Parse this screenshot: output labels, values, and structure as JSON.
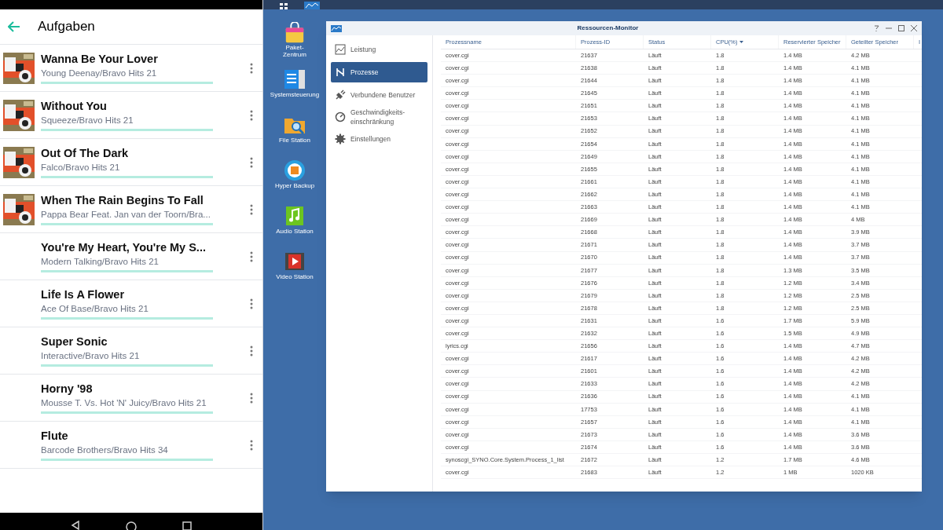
{
  "phone": {
    "header": {
      "title": "Aufgaben"
    },
    "tasks": [
      {
        "title": "Wanna Be Your Lover",
        "subtitle": "Young Deenay/Bravo Hits 21",
        "has_cover": true,
        "level": 1
      },
      {
        "title": "Without You",
        "subtitle": "Squeeze/Bravo Hits 21",
        "has_cover": true,
        "level": 1
      },
      {
        "title": "Out Of The Dark",
        "subtitle": "Falco/Bravo Hits 21",
        "has_cover": true,
        "level": 1
      },
      {
        "title": "When The Rain Begins To Fall",
        "subtitle": "Pappa Bear Feat. Jan van der Toorn/Bra...",
        "has_cover": true,
        "level": 1
      },
      {
        "title": "You're My Heart, You're My S...",
        "subtitle": "Modern Talking/Bravo Hits 21",
        "has_cover": false,
        "level": 1
      },
      {
        "title": "Life Is A Flower",
        "subtitle": "Ace Of Base/Bravo Hits 21",
        "has_cover": false,
        "level": 1
      },
      {
        "title": "Super Sonic",
        "subtitle": "Interactive/Bravo Hits 21",
        "has_cover": false,
        "level": 1
      },
      {
        "title": "Horny '98",
        "subtitle": "Mousse T. Vs. Hot 'N' Juicy/Bravo Hits 21",
        "has_cover": false,
        "level": 1
      },
      {
        "title": "Flute",
        "subtitle": "Barcode Brothers/Bravo Hits 34",
        "has_cover": false,
        "level": 1
      }
    ]
  },
  "desktop": {
    "icons": [
      {
        "label": "Paket-\nZentrum",
        "kind": "package"
      },
      {
        "label": "Systemsteuerung",
        "kind": "control"
      },
      {
        "label": "File Station",
        "kind": "folder"
      },
      {
        "label": "Hyper Backup",
        "kind": "backup"
      },
      {
        "label": "Audio Station",
        "kind": "audio"
      },
      {
        "label": "Video Station",
        "kind": "video"
      }
    ]
  },
  "window": {
    "title": "Ressourcen-Monitor",
    "sidebar": [
      {
        "label": "Leistung",
        "kind": "chart",
        "selected": false
      },
      {
        "label": "Prozesse",
        "kind": "process",
        "selected": true
      },
      {
        "label": "Verbundene Benutzer",
        "kind": "plug",
        "selected": false
      },
      {
        "label": "Geschwindigkeits-\neinschränkung",
        "kind": "gauge",
        "selected": false
      },
      {
        "label": "Einstellungen",
        "kind": "gear",
        "selected": false
      }
    ],
    "table": {
      "columns": [
        {
          "label": "Prozessname",
          "sorted": false
        },
        {
          "label": "Prozess-ID",
          "sorted": false
        },
        {
          "label": "Status",
          "sorted": false
        },
        {
          "label": "CPU(%)",
          "sorted": true
        },
        {
          "label": "Reservierter Speicher",
          "sorted": false
        },
        {
          "label": "Geteilter Speicher",
          "sorted": false
        },
        {
          "label": "I",
          "sorted": false
        }
      ],
      "rows": [
        [
          "cover.cgi",
          "21637",
          "Läuft",
          "1.8",
          "1.4 MB",
          "4.2 MB"
        ],
        [
          "cover.cgi",
          "21638",
          "Läuft",
          "1.8",
          "1.4 MB",
          "4.1 MB"
        ],
        [
          "cover.cgi",
          "21644",
          "Läuft",
          "1.8",
          "1.4 MB",
          "4.1 MB"
        ],
        [
          "cover.cgi",
          "21645",
          "Läuft",
          "1.8",
          "1.4 MB",
          "4.1 MB"
        ],
        [
          "cover.cgi",
          "21651",
          "Läuft",
          "1.8",
          "1.4 MB",
          "4.1 MB"
        ],
        [
          "cover.cgi",
          "21653",
          "Läuft",
          "1.8",
          "1.4 MB",
          "4.1 MB"
        ],
        [
          "cover.cgi",
          "21652",
          "Läuft",
          "1.8",
          "1.4 MB",
          "4.1 MB"
        ],
        [
          "cover.cgi",
          "21654",
          "Läuft",
          "1.8",
          "1.4 MB",
          "4.1 MB"
        ],
        [
          "cover.cgi",
          "21649",
          "Läuft",
          "1.8",
          "1.4 MB",
          "4.1 MB"
        ],
        [
          "cover.cgi",
          "21655",
          "Läuft",
          "1.8",
          "1.4 MB",
          "4.1 MB"
        ],
        [
          "cover.cgi",
          "21661",
          "Läuft",
          "1.8",
          "1.4 MB",
          "4.1 MB"
        ],
        [
          "cover.cgi",
          "21662",
          "Läuft",
          "1.8",
          "1.4 MB",
          "4.1 MB"
        ],
        [
          "cover.cgi",
          "21663",
          "Läuft",
          "1.8",
          "1.4 MB",
          "4.1 MB"
        ],
        [
          "cover.cgi",
          "21669",
          "Läuft",
          "1.8",
          "1.4 MB",
          "4 MB"
        ],
        [
          "cover.cgi",
          "21668",
          "Läuft",
          "1.8",
          "1.4 MB",
          "3.9 MB"
        ],
        [
          "cover.cgi",
          "21671",
          "Läuft",
          "1.8",
          "1.4 MB",
          "3.7 MB"
        ],
        [
          "cover.cgi",
          "21670",
          "Läuft",
          "1.8",
          "1.4 MB",
          "3.7 MB"
        ],
        [
          "cover.cgi",
          "21677",
          "Läuft",
          "1.8",
          "1.3 MB",
          "3.5 MB"
        ],
        [
          "cover.cgi",
          "21676",
          "Läuft",
          "1.8",
          "1.2 MB",
          "3.4 MB"
        ],
        [
          "cover.cgi",
          "21679",
          "Läuft",
          "1.8",
          "1.2 MB",
          "2.5 MB"
        ],
        [
          "cover.cgi",
          "21678",
          "Läuft",
          "1.8",
          "1.2 MB",
          "2.5 MB"
        ],
        [
          "cover.cgi",
          "21631",
          "Läuft",
          "1.6",
          "1.7 MB",
          "5.9 MB"
        ],
        [
          "cover.cgi",
          "21632",
          "Läuft",
          "1.6",
          "1.5 MB",
          "4.9 MB"
        ],
        [
          "lyrics.cgi",
          "21656",
          "Läuft",
          "1.6",
          "1.4 MB",
          "4.7 MB"
        ],
        [
          "cover.cgi",
          "21617",
          "Läuft",
          "1.6",
          "1.4 MB",
          "4.2 MB"
        ],
        [
          "cover.cgi",
          "21601",
          "Läuft",
          "1.6",
          "1.4 MB",
          "4.2 MB"
        ],
        [
          "cover.cgi",
          "21633",
          "Läuft",
          "1.6",
          "1.4 MB",
          "4.2 MB"
        ],
        [
          "cover.cgi",
          "21636",
          "Läuft",
          "1.6",
          "1.4 MB",
          "4.1 MB"
        ],
        [
          "cover.cgi",
          "17753",
          "Läuft",
          "1.6",
          "1.4 MB",
          "4.1 MB"
        ],
        [
          "cover.cgi",
          "21657",
          "Läuft",
          "1.6",
          "1.4 MB",
          "4.1 MB"
        ],
        [
          "cover.cgi",
          "21673",
          "Läuft",
          "1.6",
          "1.4 MB",
          "3.6 MB"
        ],
        [
          "cover.cgi",
          "21674",
          "Läuft",
          "1.6",
          "1.4 MB",
          "3.6 MB"
        ],
        [
          "synoscgi_SYNO.Core.System.Process_1_list",
          "21672",
          "Läuft",
          "1.2",
          "1.7 MB",
          "4.6 MB"
        ],
        [
          "cover.cgi",
          "21683",
          "Läuft",
          "1.2",
          "1 MB",
          "1020 KB"
        ]
      ]
    }
  }
}
